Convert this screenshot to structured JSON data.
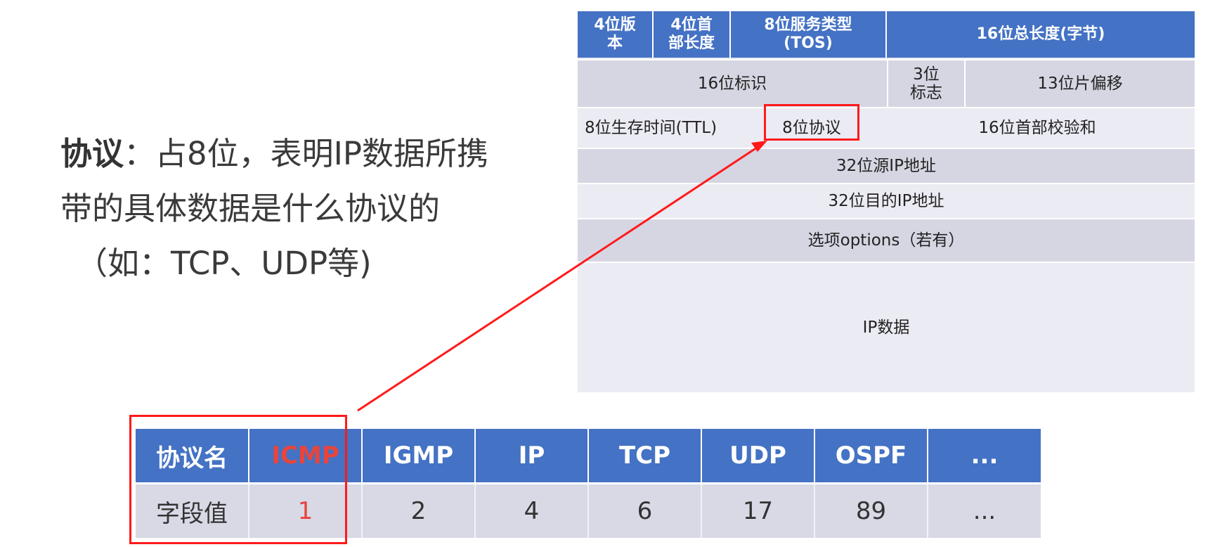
{
  "explanation": {
    "term": "协议",
    "line1_rest": "：占8位，表明IP数据所携",
    "line2": "带的具体数据是什么协议的",
    "line3": "（如：TCP、UDP等)"
  },
  "ip_header": {
    "row1": [
      "4位版本",
      "4位首部长度",
      "8位服务类型(TOS)",
      "16位总长度(字节)"
    ],
    "row2": [
      "16位标识",
      "3位标志",
      "13位片偏移"
    ],
    "row3": [
      "8位生存时间(TTL)",
      "8位协议",
      "16位首部校验和"
    ],
    "row4": "32位源IP地址",
    "row5": "32位目的IP地址",
    "row6": "选项options（若有）",
    "row7": "IP数据"
  },
  "protocol_table": {
    "header_label": "协议名",
    "value_label": "字段值",
    "names": [
      "ICMP",
      "IGMP",
      "IP",
      "TCP",
      "UDP",
      "OSPF",
      "..."
    ],
    "values": [
      "1",
      "2",
      "4",
      "6",
      "17",
      "89",
      "..."
    ]
  },
  "colors": {
    "header_blue": "#4472c4",
    "highlight_red": "#ff1a1a",
    "icmp_text": "#e8453c"
  }
}
